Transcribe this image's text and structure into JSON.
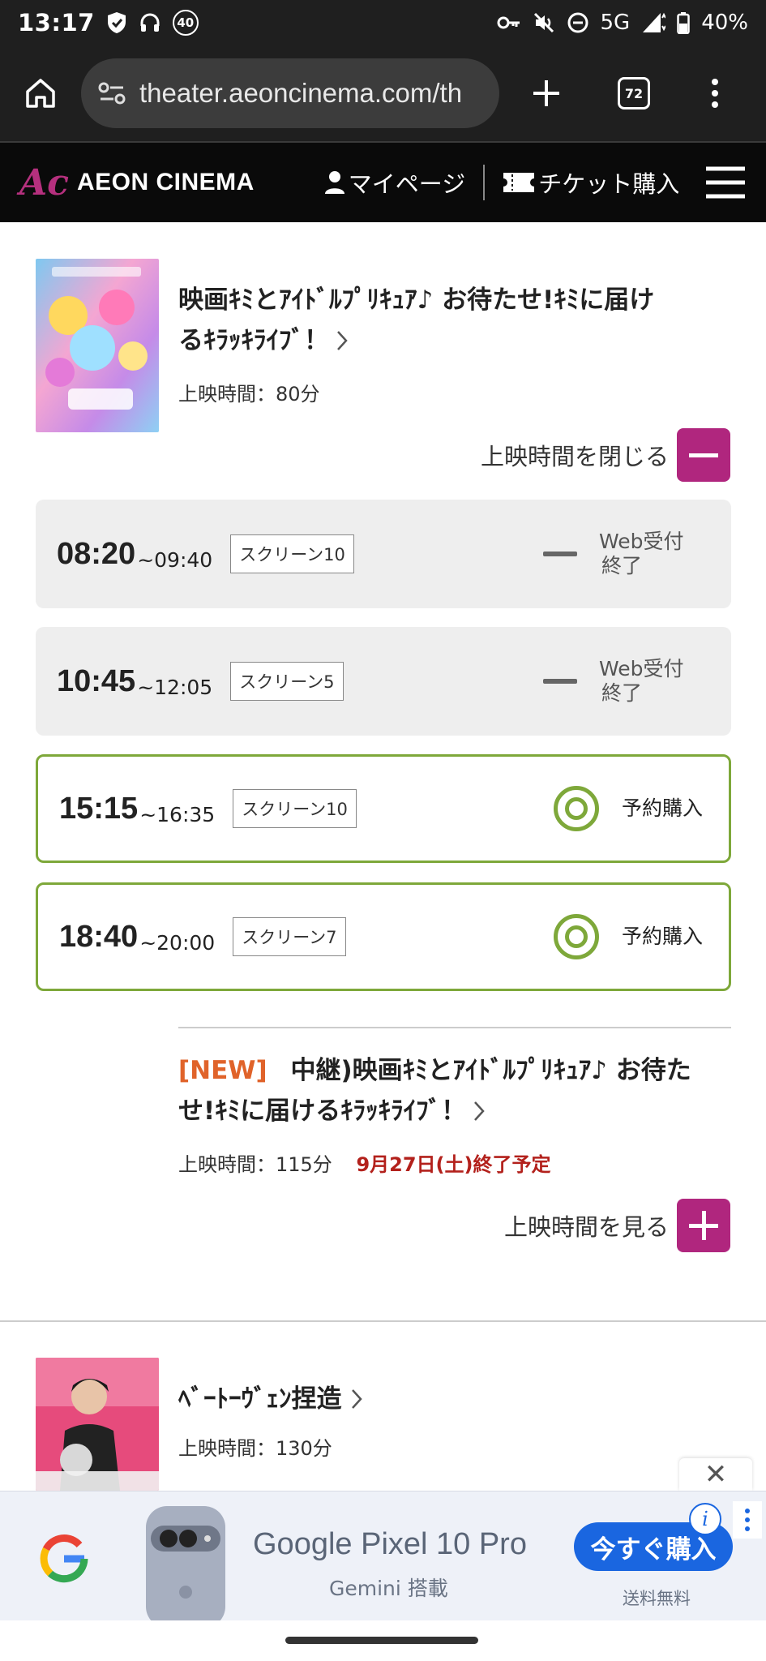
{
  "status_bar": {
    "time": "13:17",
    "notification_badge": "40",
    "network": "5G",
    "battery": "40%"
  },
  "browser": {
    "url": "theater.aeoncinema.com/th",
    "tab_count": "72"
  },
  "site_header": {
    "logo_mark": "Ac",
    "logo_text": "AEON CINEMA",
    "mypage_label": "マイページ",
    "ticket_label": "チケット購入"
  },
  "movies": [
    {
      "title": "映画ｷﾐとｱｲﾄﾞﾙﾌﾟﾘｷｭｱ♪ お待たせ!ｷﾐに届けるｷﾗｯｷﾗｲﾌﾞ！",
      "title_line1": "映画ｷﾐとｱｲﾄﾞﾙﾌﾟﾘｷｭｱ♪ お待たせ!ｷﾐに届け",
      "title_line2": "るｷﾗｯｷﾗｲﾌﾞ！",
      "runtime": "上映時間：80分",
      "toggle_label": "上映時間を閉じる",
      "showtimes": [
        {
          "start": "08:20",
          "end": "~09:40",
          "screen": "スクリーン10",
          "status": "Web受付終了",
          "status_line1": "Web受付",
          "status_line2": "終了",
          "available": false
        },
        {
          "start": "10:45",
          "end": "~12:05",
          "screen": "スクリーン5",
          "status": "Web受付終了",
          "status_line1": "Web受付",
          "status_line2": "終了",
          "available": false
        },
        {
          "start": "15:15",
          "end": "~16:35",
          "screen": "スクリーン10",
          "status": "予約購入",
          "available": true
        },
        {
          "start": "18:40",
          "end": "~20:00",
          "screen": "スクリーン7",
          "status": "予約購入",
          "available": true
        }
      ]
    },
    {
      "new_tag": "[NEW]",
      "title_line1": "中継)映画ｷﾐとｱｲﾄﾞﾙﾌﾟﾘｷｭｱ♪ お待た",
      "title_line2": "せ!ｷﾐに届けるｷﾗｯｷﾗｲﾌﾞ！",
      "runtime": "上映時間：115分",
      "end_note": "9月27日(土)終了予定",
      "toggle_label": "上映時間を見る"
    },
    {
      "title": "ﾍﾞｰﾄｰｳﾞｪﾝ捏造",
      "runtime": "上映時間：130分"
    }
  ],
  "ad": {
    "close": "✕",
    "title": "Google Pixel 10 Pro",
    "subtitle": "Gemini 搭載",
    "cta": "今すぐ購入",
    "cta_sub": "送料無料",
    "info": "i"
  },
  "colors": {
    "accent": "#b0267e",
    "available_green": "#7ea83a",
    "new_orange": "#e0632a",
    "end_red": "#b3211c"
  }
}
